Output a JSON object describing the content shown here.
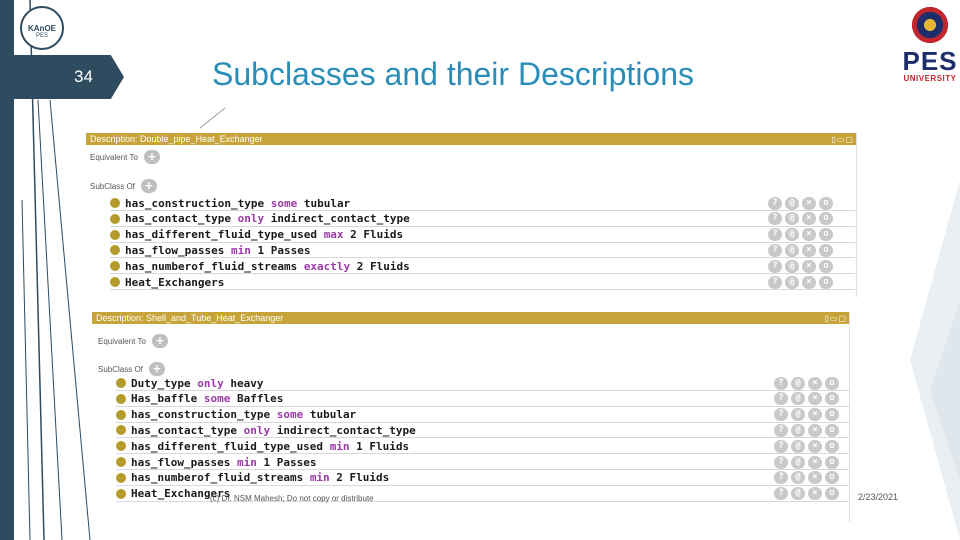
{
  "slide": {
    "number": "34",
    "title": "Subclasses and their Descriptions",
    "logo_left": {
      "line1": "KAnOE",
      "line2": "PES"
    },
    "logo_right": {
      "word": "PES",
      "sub": "UNIVERSITY"
    },
    "footer": "(c) Dr. NSM Mahesh; Do not copy or distribute",
    "date": "2/23/2021"
  },
  "colors": {
    "accent_title": "#2a8db8",
    "dark_bar": "#2e4b5f",
    "panel_header": "#c7a43a",
    "keyword": "#9b3aa8"
  },
  "panel1": {
    "header": "Description: Double_pipe_Heat_Exchanger",
    "equiv_label": "Equivalent To",
    "subclass_label": "SubClass Of",
    "rows": [
      {
        "pre": "has_construction_type ",
        "kw": "some",
        "post": " tubular"
      },
      {
        "pre": "has_contact_type ",
        "kw": "only",
        "post": " indirect_contact_type"
      },
      {
        "pre": "has_different_fluid_type_used ",
        "kw": "max",
        "post": " 2 Fluids"
      },
      {
        "pre": "has_flow_passes ",
        "kw": "min",
        "post": " 1 Passes"
      },
      {
        "pre": "has_numberof_fluid_streams ",
        "kw": "exactly",
        "post": " 2 Fluids"
      },
      {
        "pre": "Heat_Exchangers",
        "kw": "",
        "post": ""
      }
    ]
  },
  "panel2": {
    "header": "Description: Shell_and_Tube_Heat_Exchanger",
    "equiv_label": "Equivalent To",
    "subclass_label": "SubClass Of",
    "rows": [
      {
        "pre": "Duty_type ",
        "kw": "only",
        "post": " heavy"
      },
      {
        "pre": "Has_baffle ",
        "kw": "some",
        "post": " Baffles"
      },
      {
        "pre": "has_construction_type ",
        "kw": "some",
        "post": " tubular"
      },
      {
        "pre": "has_contact_type ",
        "kw": "only",
        "post": " indirect_contact_type"
      },
      {
        "pre": "has_different_fluid_type_used ",
        "kw": "min",
        "post": " 1 Fluids"
      },
      {
        "pre": "has_flow_passes ",
        "kw": "min",
        "post": " 1 Passes"
      },
      {
        "pre": "has_numberof_fluid_streams ",
        "kw": "min",
        "post": " 2 Fluids"
      },
      {
        "pre": "Heat_Exchangers",
        "kw": "",
        "post": ""
      }
    ]
  },
  "row_buttons": [
    "?",
    "@",
    "×",
    "o"
  ],
  "header_controls": "▯▭▢"
}
